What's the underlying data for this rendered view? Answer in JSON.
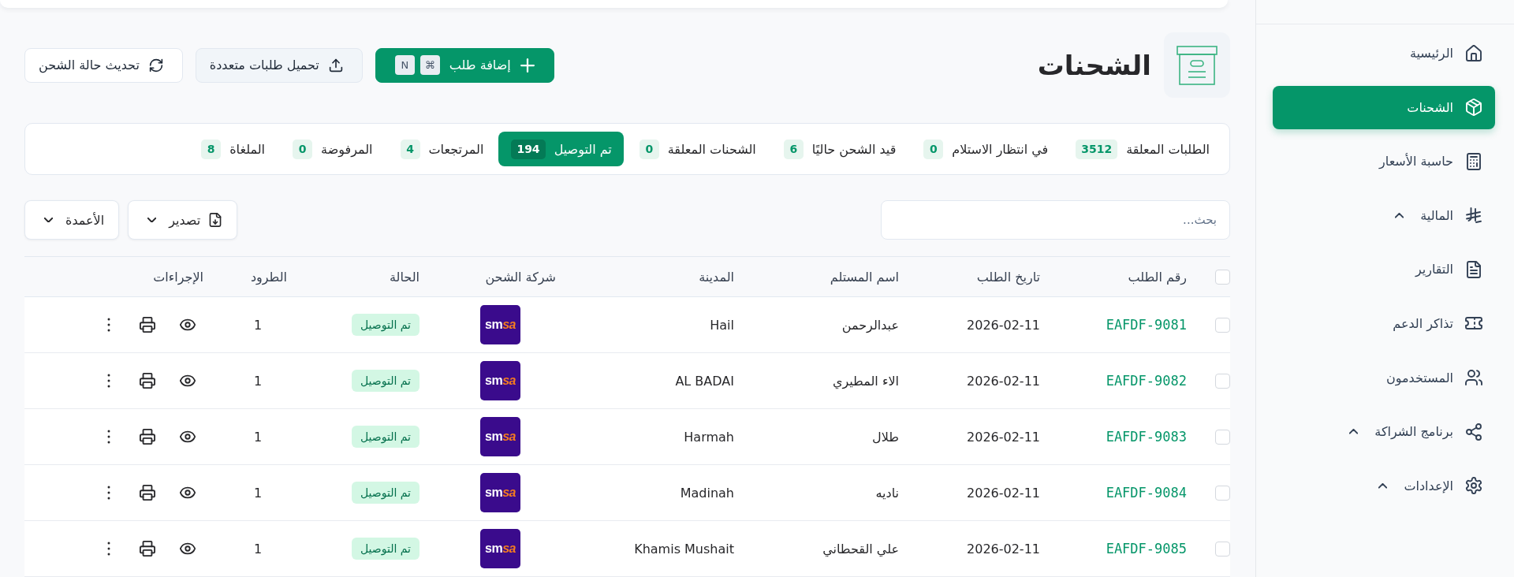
{
  "sidebar": {
    "items": [
      {
        "label": "الرئيسية",
        "kind": "link",
        "selected": false
      },
      {
        "label": "الشحنات",
        "kind": "link",
        "selected": true
      },
      {
        "label": "حاسبة الأسعار",
        "kind": "link",
        "selected": false
      },
      {
        "label": "المالية",
        "kind": "group",
        "selected": false
      },
      {
        "label": "التقارير",
        "kind": "link",
        "selected": false
      },
      {
        "label": "تذاكر الدعم",
        "kind": "link",
        "selected": false
      },
      {
        "label": "المستخدمون",
        "kind": "link",
        "selected": false
      },
      {
        "label": "برنامج الشراكة",
        "kind": "group",
        "selected": false
      },
      {
        "label": "الإعدادات",
        "kind": "group",
        "selected": false
      }
    ]
  },
  "page": {
    "title": "الشحنات"
  },
  "actions": [
    {
      "label": "إضافة طلب",
      "kind": "primary",
      "shortcut": [
        "⌘",
        "N"
      ]
    },
    {
      "label": "تحميل طلبات متعددة",
      "kind": "secondary"
    },
    {
      "label": "تحديث حالة الشحن",
      "kind": "outline"
    }
  ],
  "status_tabs": [
    {
      "label": "الطلبات المعلقة",
      "count": "3512",
      "selected": false
    },
    {
      "label": "في انتظار الاستلام",
      "count": "0",
      "selected": false
    },
    {
      "label": "قيد الشحن حاليًا",
      "count": "6",
      "selected": false
    },
    {
      "label": "الشحنات المعلقة",
      "count": "0",
      "selected": false
    },
    {
      "label": "تم التوصيل",
      "count": "194",
      "selected": true
    },
    {
      "label": "المرتجعات",
      "count": "4",
      "selected": false
    },
    {
      "label": "المرفوضة",
      "count": "0",
      "selected": false
    },
    {
      "label": "الملغاة",
      "count": "8",
      "selected": false
    }
  ],
  "search": {
    "placeholder": "بحث..."
  },
  "toolbar": {
    "buttons": [
      {
        "label": "تصدير"
      },
      {
        "label": "الأعمدة"
      }
    ]
  },
  "table": {
    "select_all": {
      "checked": false
    },
    "columns": [
      "رقم الطلب",
      "تاريخ الطلب",
      "اسم المستلم",
      "المدينة",
      "شركة الشحن",
      "الحالة",
      "الطرود",
      "الإجراءات"
    ],
    "rows": [
      {
        "checked": false,
        "order_number": "EAFDF-9081",
        "date": "2026-02-11",
        "recipient": "عبدالرحمن",
        "city": "Hail",
        "carrier_logo": {
          "text": "sm",
          "accent": "sa"
        },
        "status": "تم التوصيل",
        "parcels": "1"
      },
      {
        "checked": false,
        "order_number": "EAFDF-9082",
        "date": "2026-02-11",
        "recipient": "الاء المطيري",
        "city": "AL BADAI",
        "carrier_logo": {
          "text": "sm",
          "accent": "sa"
        },
        "status": "تم التوصيل",
        "parcels": "1"
      },
      {
        "checked": false,
        "order_number": "EAFDF-9083",
        "date": "2026-02-11",
        "recipient": "طلال",
        "city": "Harmah",
        "carrier_logo": {
          "text": "sm",
          "accent": "sa"
        },
        "status": "تم التوصيل",
        "parcels": "1"
      },
      {
        "checked": false,
        "order_number": "EAFDF-9084",
        "date": "2026-02-11",
        "recipient": "ناديه",
        "city": "Madinah",
        "carrier_logo": {
          "text": "sm",
          "accent": "sa"
        },
        "status": "تم التوصيل",
        "parcels": "1"
      },
      {
        "checked": false,
        "order_number": "EAFDF-9085",
        "date": "2026-02-11",
        "recipient": "علي القحطاني",
        "city": "Khamis Mushait",
        "carrier_logo": {
          "text": "sm",
          "accent": "sa"
        },
        "status": "تم التوصيل",
        "parcels": "1"
      }
    ]
  }
}
